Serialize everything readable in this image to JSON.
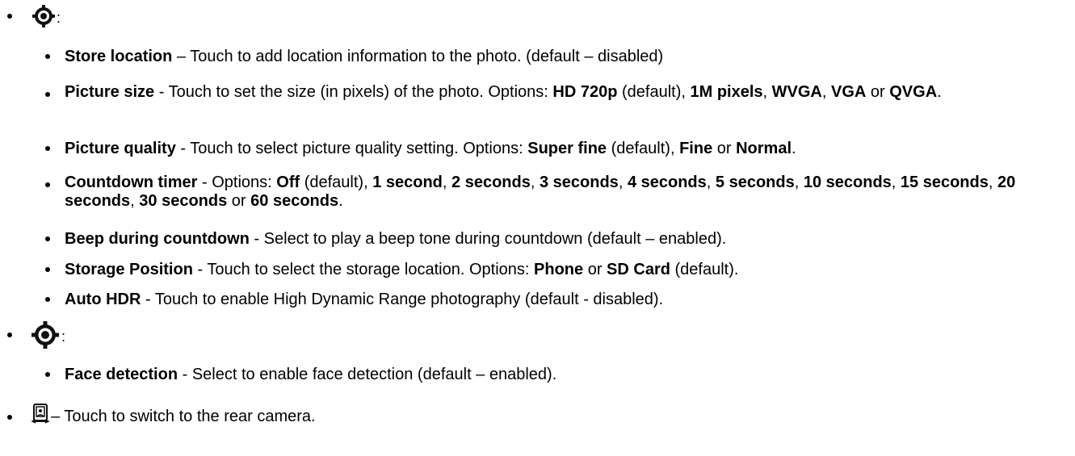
{
  "top_items": [
    {
      "icon": "gear-icon",
      "suffix": ":",
      "sub_items": [
        {
          "title": "Store location",
          "sep": " – ",
          "text": "Touch to add location information to the photo. (default – disabled)"
        },
        {
          "title": "Picture size",
          "sep": " - ",
          "text_prefix": "Touch to set the size (in pixels) of the photo. Options: ",
          "options": [
            {
              "label": "HD 720p",
              "after": " (default), "
            },
            {
              "label": "1M pixels",
              "after": ", "
            },
            {
              "label": "WVGA",
              "after": ", "
            },
            {
              "label": "VGA",
              "after": " or "
            },
            {
              "label": "QVGA",
              "after": "."
            }
          ]
        },
        {
          "title": "Picture quality",
          "sep": " - ",
          "text_prefix": "Touch to select picture quality setting. Options: ",
          "options": [
            {
              "label": "Super fine",
              "after": " (default), "
            },
            {
              "label": "Fine",
              "after": " or "
            },
            {
              "label": "Normal",
              "after": "."
            }
          ]
        },
        {
          "title": "Countdown timer",
          "sep": " - ",
          "text_prefix": "Options: ",
          "options": [
            {
              "label": "Off",
              "after": " (default), "
            },
            {
              "label": "1 second",
              "after": ", "
            },
            {
              "label": "2 seconds",
              "after": ", "
            },
            {
              "label": "3 seconds",
              "after": ", "
            },
            {
              "label": "4 seconds",
              "after": ", "
            },
            {
              "label": "5 seconds",
              "after": ", "
            },
            {
              "label": "10 seconds",
              "after": ", "
            },
            {
              "label": "15 seconds",
              "after": ", "
            },
            {
              "label": "20 seconds",
              "after": ", "
            },
            {
              "label": "30 seconds",
              "after": " or "
            },
            {
              "label": "60 seconds",
              "after": "."
            }
          ]
        },
        {
          "title": "Beep during countdown",
          "sep": " - ",
          "text": "Select to play a beep tone during countdown (default – enabled)."
        },
        {
          "title": "Storage Position",
          "sep": " - ",
          "text_prefix": "Touch to select the storage location. Options: ",
          "options": [
            {
              "label": "Phone",
              "after": " or "
            },
            {
              "label": "SD Card",
              "after": " (default)."
            }
          ]
        },
        {
          "title": "Auto HDR",
          "sep": " - ",
          "text": "Touch to enable High Dynamic Range photography (default - disabled)."
        }
      ]
    },
    {
      "icon": "gear-icon",
      "suffix": ":",
      "sub_items": [
        {
          "title": "Face detection",
          "sep": " - ",
          "text": "Select to enable face detection (default – enabled)."
        }
      ]
    },
    {
      "icon": "switch-camera-icon",
      "text": " – Touch to switch to the rear camera."
    }
  ]
}
